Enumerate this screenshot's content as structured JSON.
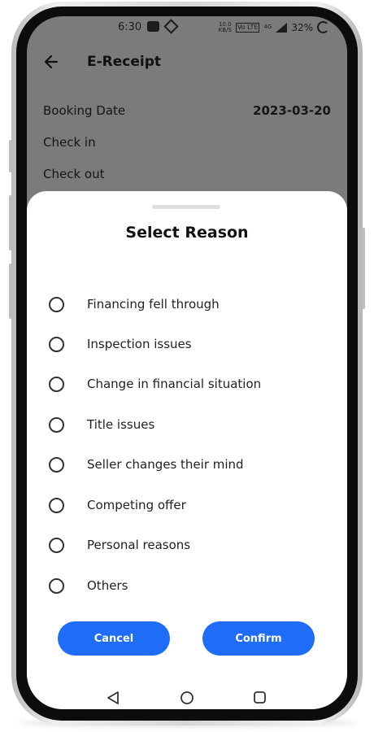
{
  "status_bar": {
    "time": "6:30",
    "net_speed_value": "10.0",
    "net_speed_unit": "KB/S",
    "volte": "Vo LTE",
    "network": "4G",
    "battery": "32%"
  },
  "header": {
    "title": "E-Receipt"
  },
  "receipt_rows": [
    {
      "label": "Booking Date",
      "value": "2023-03-20"
    },
    {
      "label": "Check in",
      "value": ""
    },
    {
      "label": "Check out",
      "value": ""
    }
  ],
  "sheet": {
    "title": "Select Reason",
    "reasons": [
      "Financing fell through",
      "Inspection issues",
      "Change in financial situation",
      "Title issues",
      "Seller changes their mind",
      "Competing offer",
      "Personal reasons",
      "Others"
    ],
    "cancel_label": "Cancel",
    "confirm_label": "Confirm"
  },
  "colors": {
    "accent": "#1f6cf6",
    "overlay": "#7b7b7b",
    "sheet": "#ffffff"
  },
  "icons": [
    "back-arrow-icon",
    "radio-icon",
    "nav-back-icon",
    "nav-home-icon",
    "nav-recents-icon"
  ]
}
